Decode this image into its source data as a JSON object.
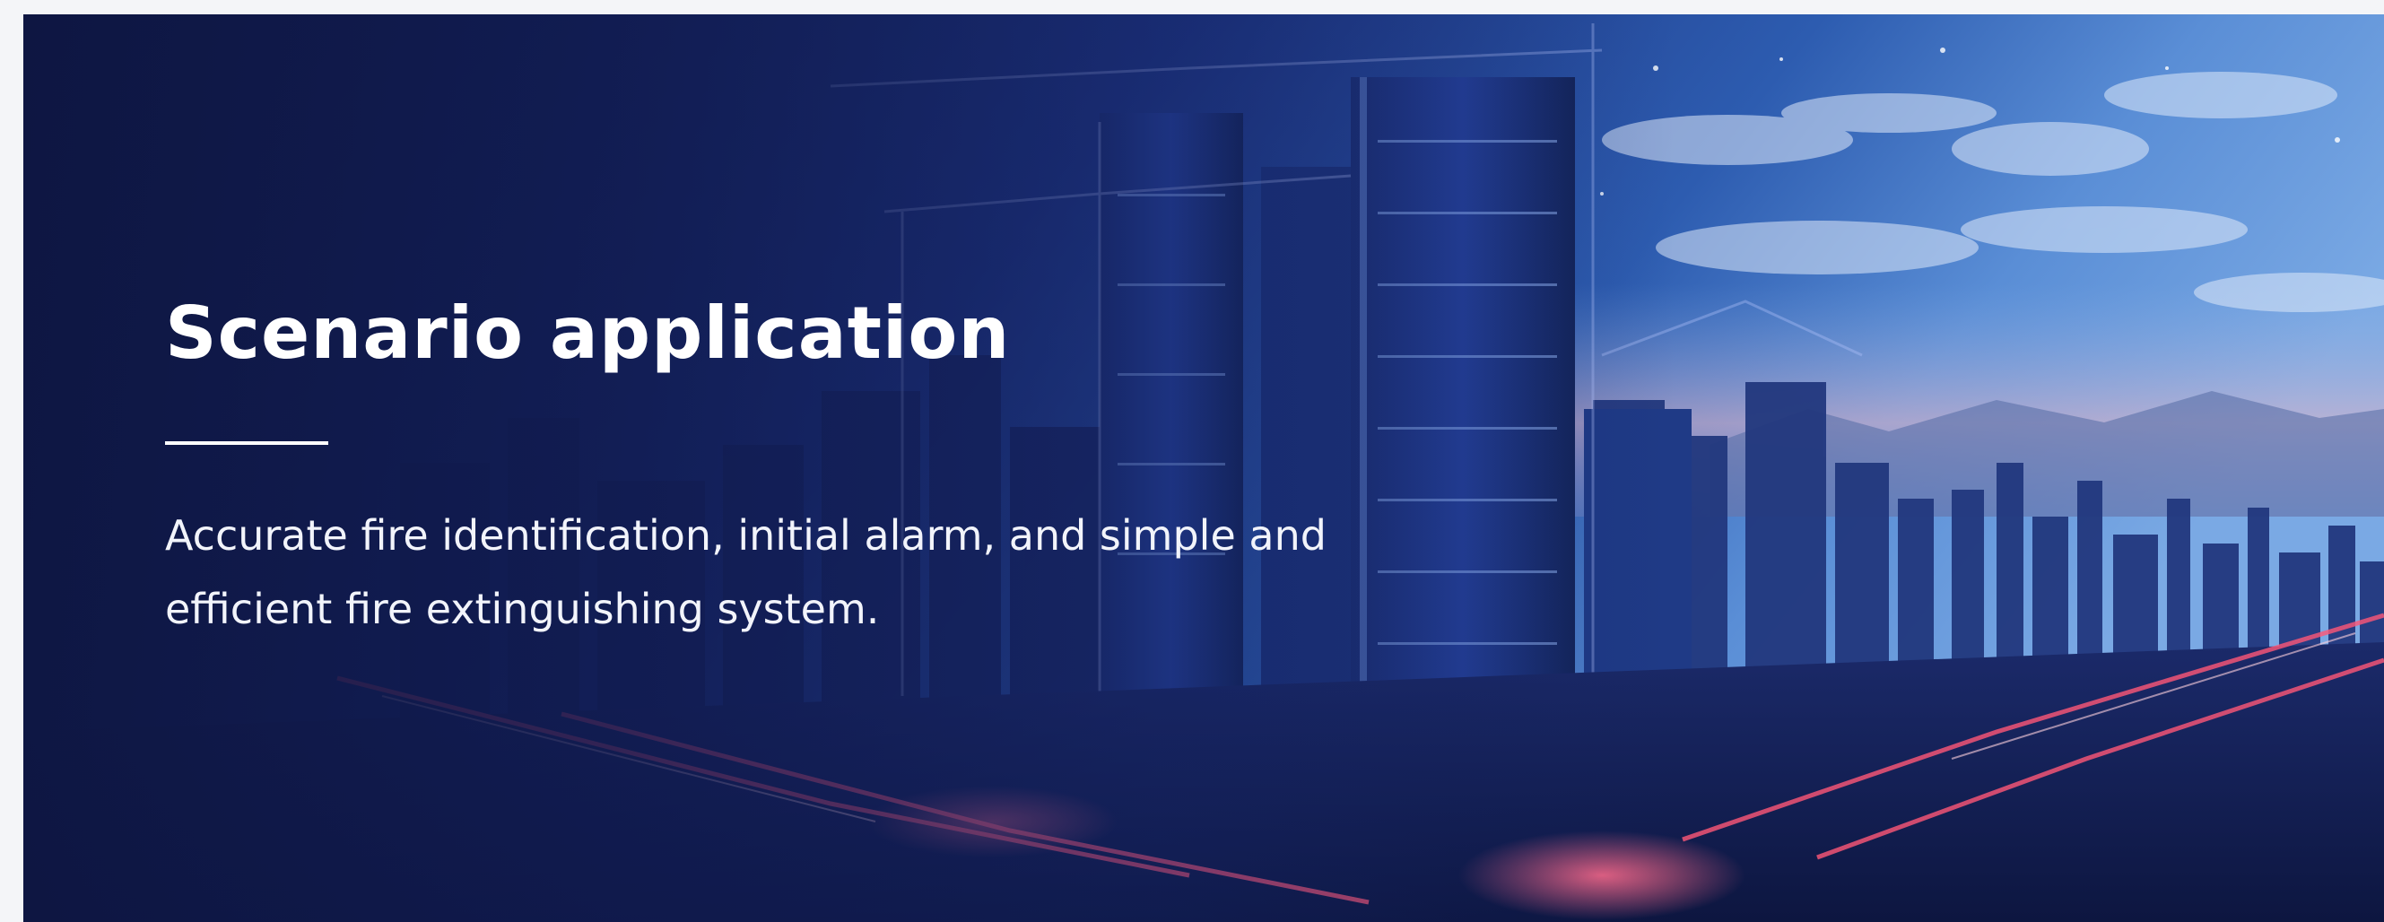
{
  "banner": {
    "title": "Scenario application",
    "description": "Accurate fire identification, initial alarm, and simple and efficient fire extinguishing system.",
    "background_image": "city-skyline-night-image",
    "colors": {
      "deep_navy": "#0f1a45",
      "sky_blue": "#3e7bd0",
      "road_light_red": "#ff4a6a",
      "text": "#ffffff"
    }
  }
}
